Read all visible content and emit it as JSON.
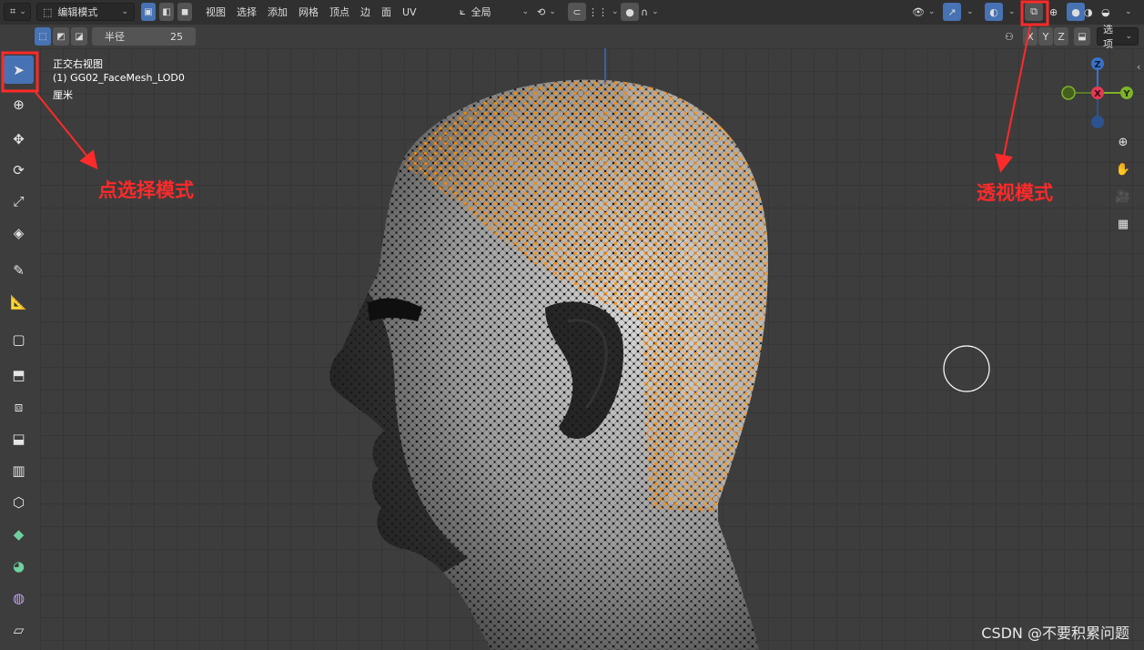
{
  "header": {
    "mode_dropdown": "编辑模式",
    "menus": [
      "视图",
      "选择",
      "添加",
      "网格",
      "顶点",
      "边",
      "面",
      "UV"
    ],
    "transform_orientation": "全局",
    "options_label": "选项"
  },
  "tool_settings": {
    "radius_label": "半径",
    "radius_value": "25",
    "axes": [
      "X",
      "Y",
      "Z"
    ]
  },
  "viewport_info": {
    "view_name": "正交右视图",
    "object_name": "(1) GG02_FaceMesh_LOD0",
    "units": "厘米"
  },
  "gizmo": {
    "z_label": "Z",
    "x_label": "X",
    "y_label": "Y"
  },
  "annotations": {
    "select_mode": "点选择模式",
    "xray_mode": "透视模式"
  },
  "watermark": "CSDN @不要积累问题",
  "colors": {
    "active_blue": "#4772b3",
    "selection_orange": "#ff8a00",
    "annotation_red": "#ff2a2a"
  }
}
